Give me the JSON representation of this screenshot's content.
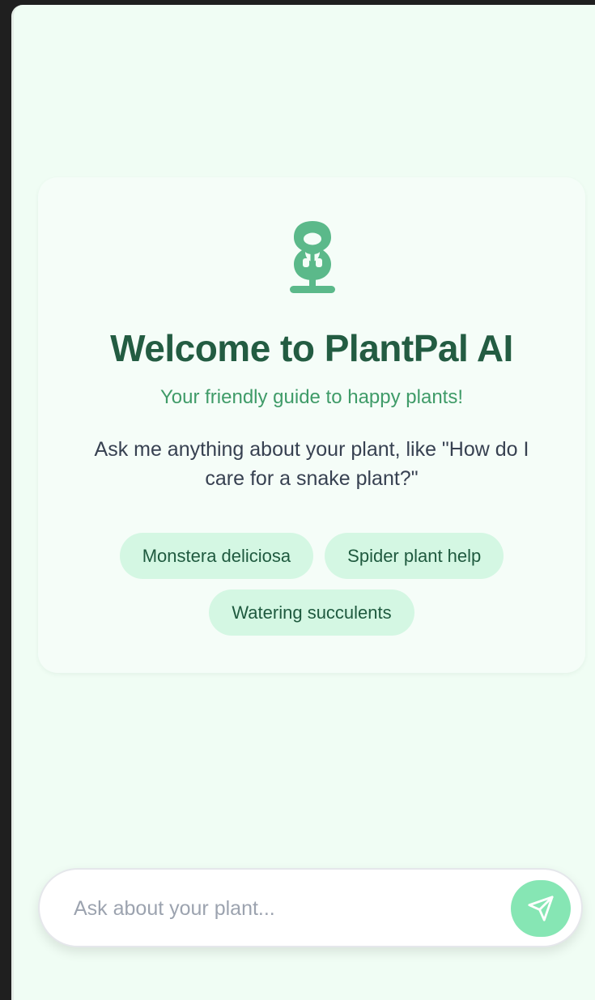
{
  "welcome": {
    "icon": "plant-icon",
    "title": "Welcome to PlantPal AI",
    "subtitle": "Your friendly guide to happy plants!",
    "description": "Ask me anything about your plant, like \"How do I care for a snake plant?\"",
    "suggestions": [
      {
        "label": "Monstera deliciosa"
      },
      {
        "label": "Spider plant help"
      },
      {
        "label": "Watering succulents"
      }
    ]
  },
  "composer": {
    "placeholder": "Ask about your plant...",
    "value": "",
    "send_icon": "send-icon"
  },
  "colors": {
    "page_background": "#f0fdf4",
    "title": "#235c42",
    "subtitle": "#3f9b68",
    "chip_background": "#d4f7e3",
    "accent": "#5bb98a",
    "send_button": "#86e6b4"
  }
}
